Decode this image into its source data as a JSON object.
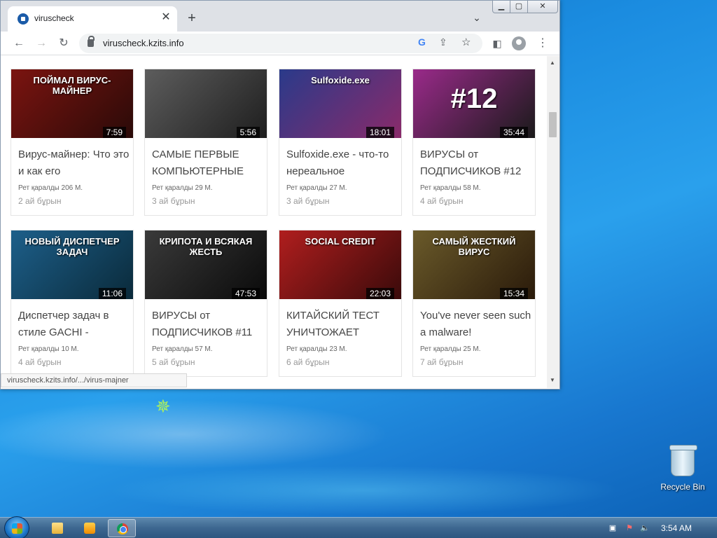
{
  "browser": {
    "tab_title": "viruscheck",
    "url": "viruscheck.kzits.info",
    "status_url": "viruscheck.kzits.info/.../virus-majner"
  },
  "videos": [
    {
      "thumb_text": "ПОЙМАЛ ВИРУС-МАЙНЕР",
      "duration": "7:59",
      "title": "Вирус-майнер: Что это и как его",
      "views": "Рет қаралды 206 М.",
      "date": "2 ай бұрын",
      "bg": "#7b1410",
      "bg2": "#2a0a08"
    },
    {
      "thumb_text": "",
      "duration": "5:56",
      "title": "САМЫЕ ПЕРВЫЕ КОМПЬЮТЕРНЫЕ",
      "views": "Рет қаралды 29 М.",
      "date": "3 ай бұрын",
      "bg": "#5d5d5d",
      "bg2": "#1e1e1e"
    },
    {
      "thumb_text": "Sulfoxide.exe",
      "duration": "18:01",
      "title": "Sulfoxide.exe - что-то нереальное",
      "views": "Рет қаралды 27 М.",
      "date": "3 ай бұрын",
      "bg": "#2a3a8a",
      "bg2": "#8a2a6a"
    },
    {
      "thumb_text": "#12",
      "duration": "35:44",
      "title": "ВИРУСЫ от ПОДПИСЧИКОВ #12",
      "views": "Рет қаралды 58 М.",
      "date": "4 ай бұрын",
      "bg": "#9a2a8a",
      "bg2": "#1a1a1a"
    },
    {
      "thumb_text": "НОВЫЙ ДИСПЕТЧЕР ЗАДАЧ",
      "duration": "11:06",
      "title": "Диспетчер задач в стиле GACHI -",
      "views": "Рет қаралды 10 М.",
      "date": "4 ай бұрын",
      "bg": "#1d5f8a",
      "bg2": "#0a2a3a"
    },
    {
      "thumb_text": "КРИПОТА И ВСЯКАЯ ЖЕСТЬ",
      "duration": "47:53",
      "title": "ВИРУСЫ от ПОДПИСЧИКОВ #11",
      "views": "Рет қаралды 57 М.",
      "date": "5 ай бұрын",
      "bg": "#3a3a3a",
      "bg2": "#0a0a0a"
    },
    {
      "thumb_text": "SOCIAL CREDIT",
      "duration": "22:03",
      "title": "КИТАЙСКИЙ ТЕСТ УНИЧТОЖАЕТ",
      "views": "Рет қаралды 23 М.",
      "date": "6 ай бұрын",
      "bg": "#b01e1e",
      "bg2": "#3a0a0a"
    },
    {
      "thumb_text": "САМЫЙ ЖЕСТКИЙ ВИРУС",
      "duration": "15:34",
      "title": "You've never seen such a malware!",
      "views": "Рет қаралды 25 М.",
      "date": "7 ай бұрын",
      "bg": "#6a5a2a",
      "bg2": "#2a1a0a"
    }
  ],
  "desktop": {
    "recycle_bin_label": "Recycle Bin"
  },
  "taskbar": {
    "clock": "3:54 AM"
  }
}
